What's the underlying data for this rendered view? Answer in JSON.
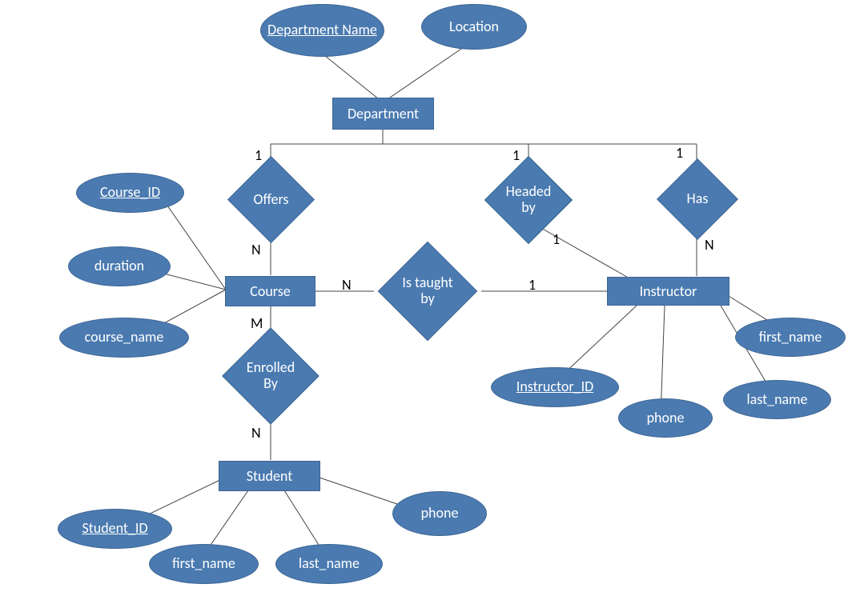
{
  "entities": {
    "department": "Department",
    "course": "Course",
    "instructor": "Instructor",
    "student": "Student"
  },
  "attributes": {
    "department_name": "Department Name",
    "location": "Location",
    "course_id": "Course_ID",
    "duration": "duration",
    "course_name": "course_name",
    "instructor_id": "Instructor_ID",
    "instr_first_name": "first_name",
    "instr_last_name": "last_name",
    "instr_phone": "phone",
    "student_id": "Student_ID",
    "stu_first_name": "first_name",
    "stu_last_name": "last_name",
    "stu_phone": "phone"
  },
  "relationships": {
    "offers": "Offers",
    "headed_by": "Headed by",
    "has": "Has",
    "is_taught_by": "Is taught by",
    "enrolled_by": "Enrolled By"
  },
  "cardinalities": {
    "dept_offers": "1",
    "offers_course": "N",
    "dept_headed": "1",
    "headed_instr": "1",
    "dept_has": "1",
    "has_instr": "N",
    "course_taught": "N",
    "taught_instr": "1",
    "course_enroll": "M",
    "enroll_student": "N"
  }
}
